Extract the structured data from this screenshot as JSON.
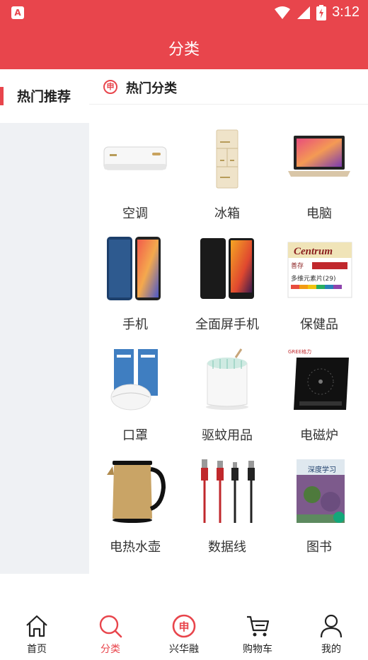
{
  "status_bar": {
    "time": "3:12",
    "app_icon_letter": "A"
  },
  "header": {
    "title": "分类"
  },
  "sidebar": {
    "items": [
      {
        "label": "热门推荐",
        "active": true
      }
    ]
  },
  "section": {
    "title": "热门分类",
    "logo_char": "申"
  },
  "categories": [
    {
      "name": "空调",
      "icon": "air-conditioner"
    },
    {
      "name": "冰箱",
      "icon": "refrigerator"
    },
    {
      "name": "电脑",
      "icon": "laptop"
    },
    {
      "name": "手机",
      "icon": "smartphone"
    },
    {
      "name": "全面屏手机",
      "icon": "fullscreen-phone"
    },
    {
      "name": "保健品",
      "icon": "supplement-box"
    },
    {
      "name": "口罩",
      "icon": "face-mask"
    },
    {
      "name": "驱蚊用品",
      "icon": "mosquito-repeller"
    },
    {
      "name": "电磁炉",
      "icon": "induction-cooker"
    },
    {
      "name": "电热水壶",
      "icon": "electric-kettle"
    },
    {
      "name": "数据线",
      "icon": "data-cable"
    },
    {
      "name": "图书",
      "icon": "book"
    }
  ],
  "product_texts": {
    "centrum": "Centrum",
    "centrum_cn": "善存",
    "centrum_sub": "多维元素片(29)",
    "gree": "GREE格力",
    "book_title": "深度学习"
  },
  "bottom_nav": [
    {
      "label": "首页",
      "icon": "home-icon",
      "active": false
    },
    {
      "label": "分类",
      "icon": "search-icon",
      "active": true
    },
    {
      "label": "兴华融",
      "icon": "brand-logo-icon",
      "active": false,
      "logo_char": "申"
    },
    {
      "label": "购物车",
      "icon": "cart-icon",
      "active": false
    },
    {
      "label": "我的",
      "icon": "user-icon",
      "active": false
    }
  ],
  "colors": {
    "accent": "#e8454c",
    "sidebar_bg": "#eff1f4"
  }
}
